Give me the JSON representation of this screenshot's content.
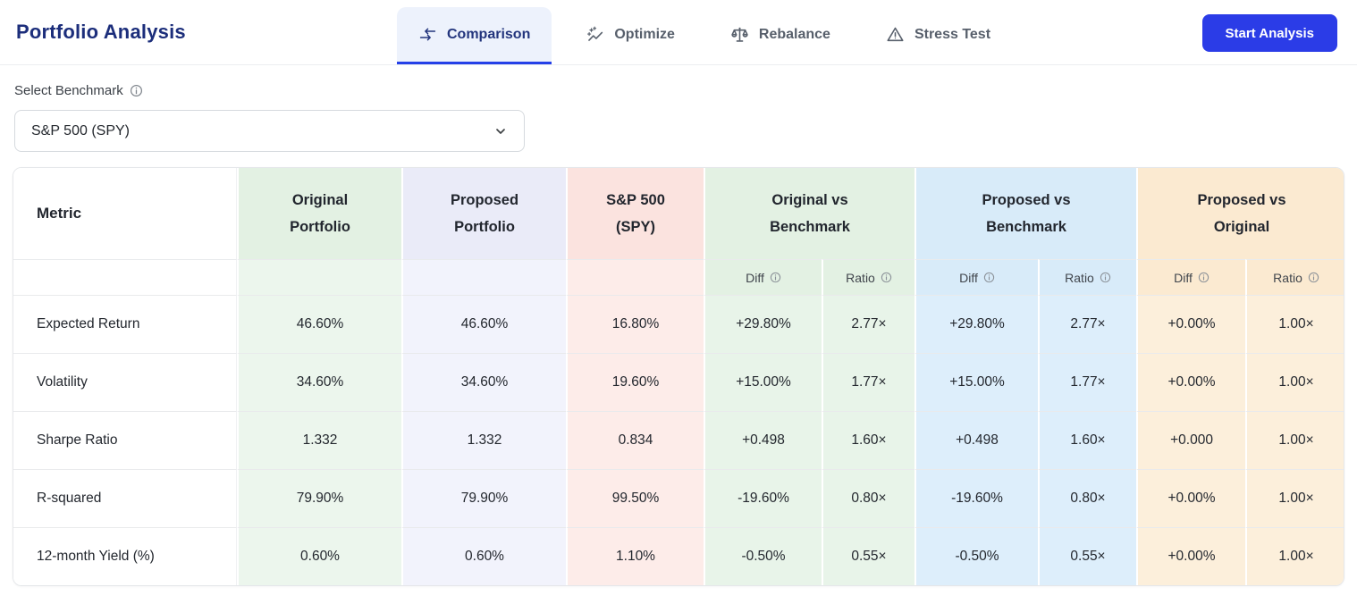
{
  "page": {
    "title": "Portfolio Analysis"
  },
  "tabs": [
    {
      "label": "Comparison",
      "icon": "compare-arrows-icon",
      "active": true
    },
    {
      "label": "Optimize",
      "icon": "sparkles-icon",
      "active": false
    },
    {
      "label": "Rebalance",
      "icon": "balance-scale-icon",
      "active": false
    },
    {
      "label": "Stress Test",
      "icon": "warning-triangle-icon",
      "active": false
    }
  ],
  "actions": {
    "start_analysis": "Start Analysis"
  },
  "benchmark": {
    "label": "Select Benchmark",
    "selected": "S&P 500 (SPY)"
  },
  "table": {
    "metric_header": "Metric",
    "columns": {
      "original": {
        "line1": "Original",
        "line2": "Portfolio"
      },
      "proposed": {
        "line1": "Proposed",
        "line2": "Portfolio"
      },
      "benchmark": {
        "line1": "S&P 500",
        "line2": "(SPY)"
      },
      "ovb": {
        "line1": "Original vs",
        "line2": "Benchmark"
      },
      "pvb": {
        "line1": "Proposed vs",
        "line2": "Benchmark"
      },
      "pvo": {
        "line1": "Proposed vs",
        "line2": "Original"
      }
    },
    "subheaders": {
      "diff": "Diff",
      "ratio": "Ratio"
    },
    "rows": [
      {
        "metric": "Expected Return",
        "original": "46.60%",
        "proposed": "46.60%",
        "benchmark": "16.80%",
        "ovb_diff": "+29.80%",
        "ovb_ratio": "2.77×",
        "pvb_diff": "+29.80%",
        "pvb_ratio": "2.77×",
        "pvo_diff": "+0.00%",
        "pvo_ratio": "1.00×"
      },
      {
        "metric": "Volatility",
        "original": "34.60%",
        "proposed": "34.60%",
        "benchmark": "19.60%",
        "ovb_diff": "+15.00%",
        "ovb_ratio": "1.77×",
        "pvb_diff": "+15.00%",
        "pvb_ratio": "1.77×",
        "pvo_diff": "+0.00%",
        "pvo_ratio": "1.00×"
      },
      {
        "metric": "Sharpe Ratio",
        "original": "1.332",
        "proposed": "1.332",
        "benchmark": "0.834",
        "ovb_diff": "+0.498",
        "ovb_ratio": "1.60×",
        "pvb_diff": "+0.498",
        "pvb_ratio": "1.60×",
        "pvo_diff": "+0.000",
        "pvo_ratio": "1.00×"
      },
      {
        "metric": "R-squared",
        "original": "79.90%",
        "proposed": "79.90%",
        "benchmark": "99.50%",
        "ovb_diff": "-19.60%",
        "ovb_ratio": "0.80×",
        "pvb_diff": "-19.60%",
        "pvb_ratio": "0.80×",
        "pvo_diff": "+0.00%",
        "pvo_ratio": "1.00×"
      },
      {
        "metric": "12-month Yield (%)",
        "original": "0.60%",
        "proposed": "0.60%",
        "benchmark": "1.10%",
        "ovb_diff": "-0.50%",
        "ovb_ratio": "0.55×",
        "pvb_diff": "-0.50%",
        "pvb_ratio": "0.55×",
        "pvo_diff": "+0.00%",
        "pvo_ratio": "1.00×"
      }
    ]
  },
  "colors": {
    "title_navy": "#1c2e7b",
    "accent_blue": "#2b3ce7",
    "active_tab_bg": "#edf2fc",
    "active_tab_underline": "#2540e8",
    "green_header": "#e3f1e3",
    "green_body": "#ecf6ed",
    "purple_header": "#eaebf8",
    "purple_body": "#f2f3fc",
    "red_header": "#fbe3df",
    "red_body": "#fdece9",
    "blue_header": "#d8ebf9",
    "blue_body": "#ddeefb",
    "orange_header": "#fbead1",
    "orange_body": "#fcefdb"
  }
}
